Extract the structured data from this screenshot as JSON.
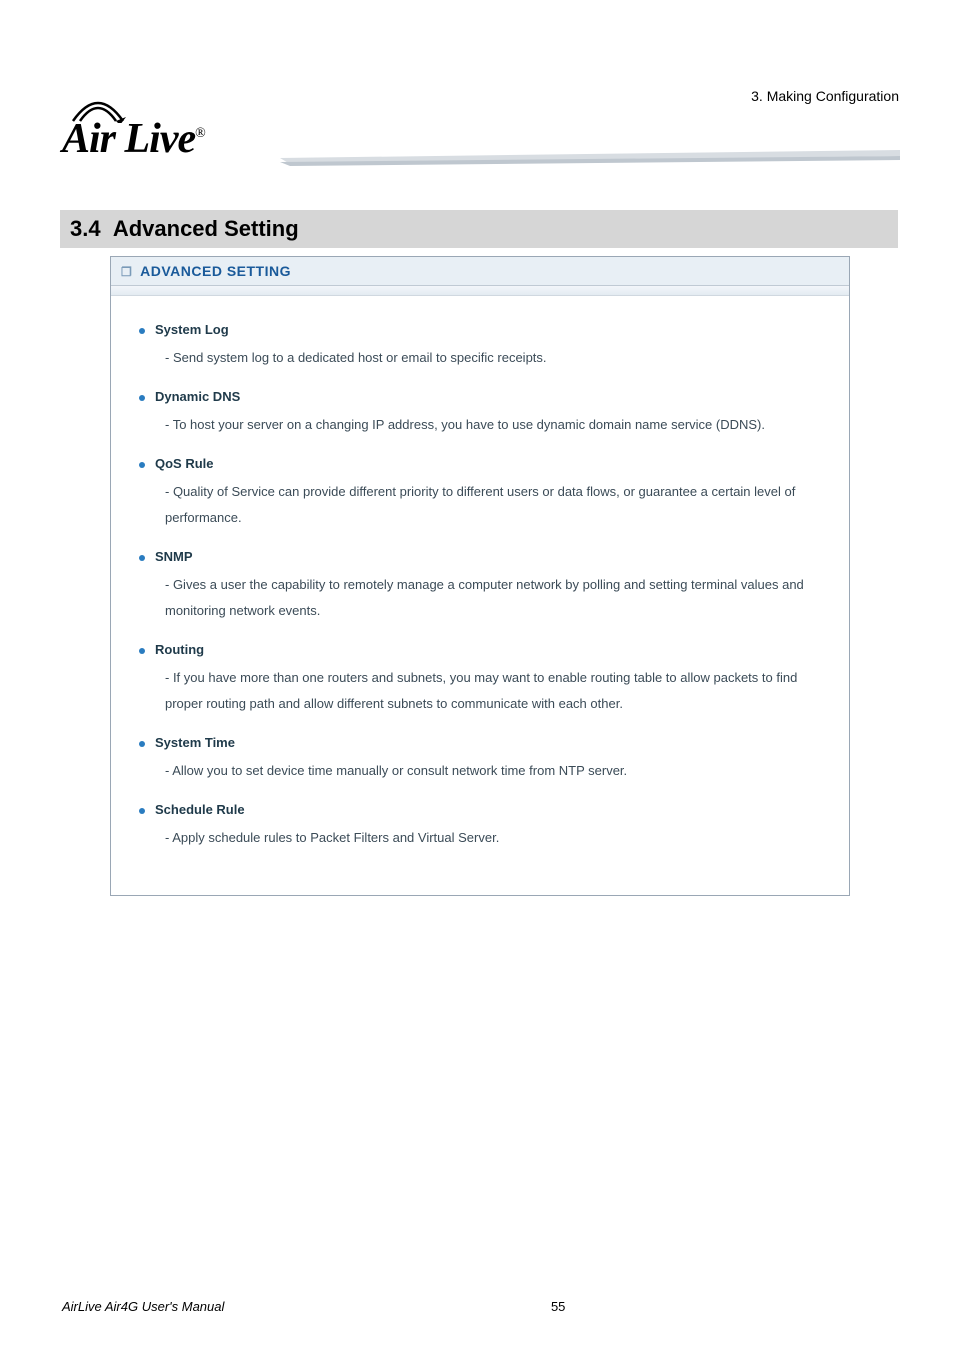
{
  "chapter_label": "3.  Making  Configuration",
  "logo_text": "Air Live",
  "section_number": "3.4",
  "section_title": "Advanced Setting",
  "panel_title": "ADVANCED SETTING",
  "items": [
    {
      "title": "System Log",
      "desc": "- Send system log to a dedicated host or email to specific receipts."
    },
    {
      "title": "Dynamic DNS",
      "desc": "- To host your server on a changing IP address, you have to use dynamic domain name service (DDNS)."
    },
    {
      "title": "QoS Rule",
      "desc": "- Quality of Service can provide different priority to different users or data flows, or guarantee a certain level of performance."
    },
    {
      "title": "SNMP",
      "desc": "- Gives a user the capability to remotely manage a computer network by polling and setting terminal values and monitoring network events."
    },
    {
      "title": "Routing",
      "desc": "- If you have more than one routers and subnets, you may want to enable routing table to allow packets to find proper routing path and allow different subnets to communicate with each other."
    },
    {
      "title": "System Time",
      "desc": "- Allow you to set device time manually or consult network time from NTP server."
    },
    {
      "title": "Schedule Rule",
      "desc": "- Apply schedule rules to Packet Filters and Virtual Server."
    }
  ],
  "footer_manual": "AirLive Air4G User's Manual",
  "footer_page": "55"
}
